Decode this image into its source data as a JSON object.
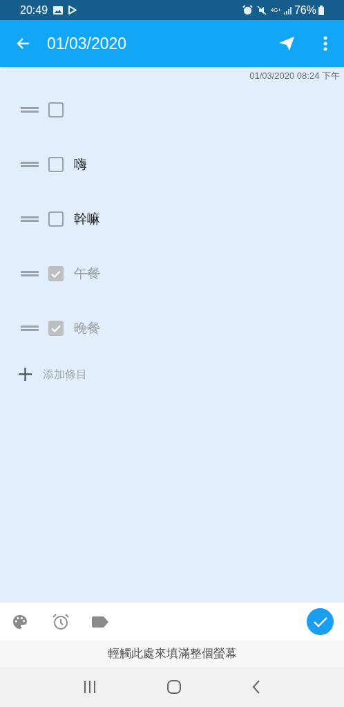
{
  "status_bar": {
    "time": "20:49",
    "network": "4G+",
    "battery": "76%"
  },
  "app_bar": {
    "title": "01/03/2020"
  },
  "timestamp": "01/03/2020 08:24 下午",
  "items": [
    {
      "checked": false
    },
    {
      "text": "嗨",
      "checked": false
    },
    {
      "text": "幹嘛",
      "checked": false
    },
    {
      "text": "午餐",
      "checked": true
    },
    {
      "text": "晚餐",
      "checked": true
    }
  ],
  "add_item": {
    "label": "添加條目"
  },
  "banner": "輕觸此處來填滿整個螢幕"
}
